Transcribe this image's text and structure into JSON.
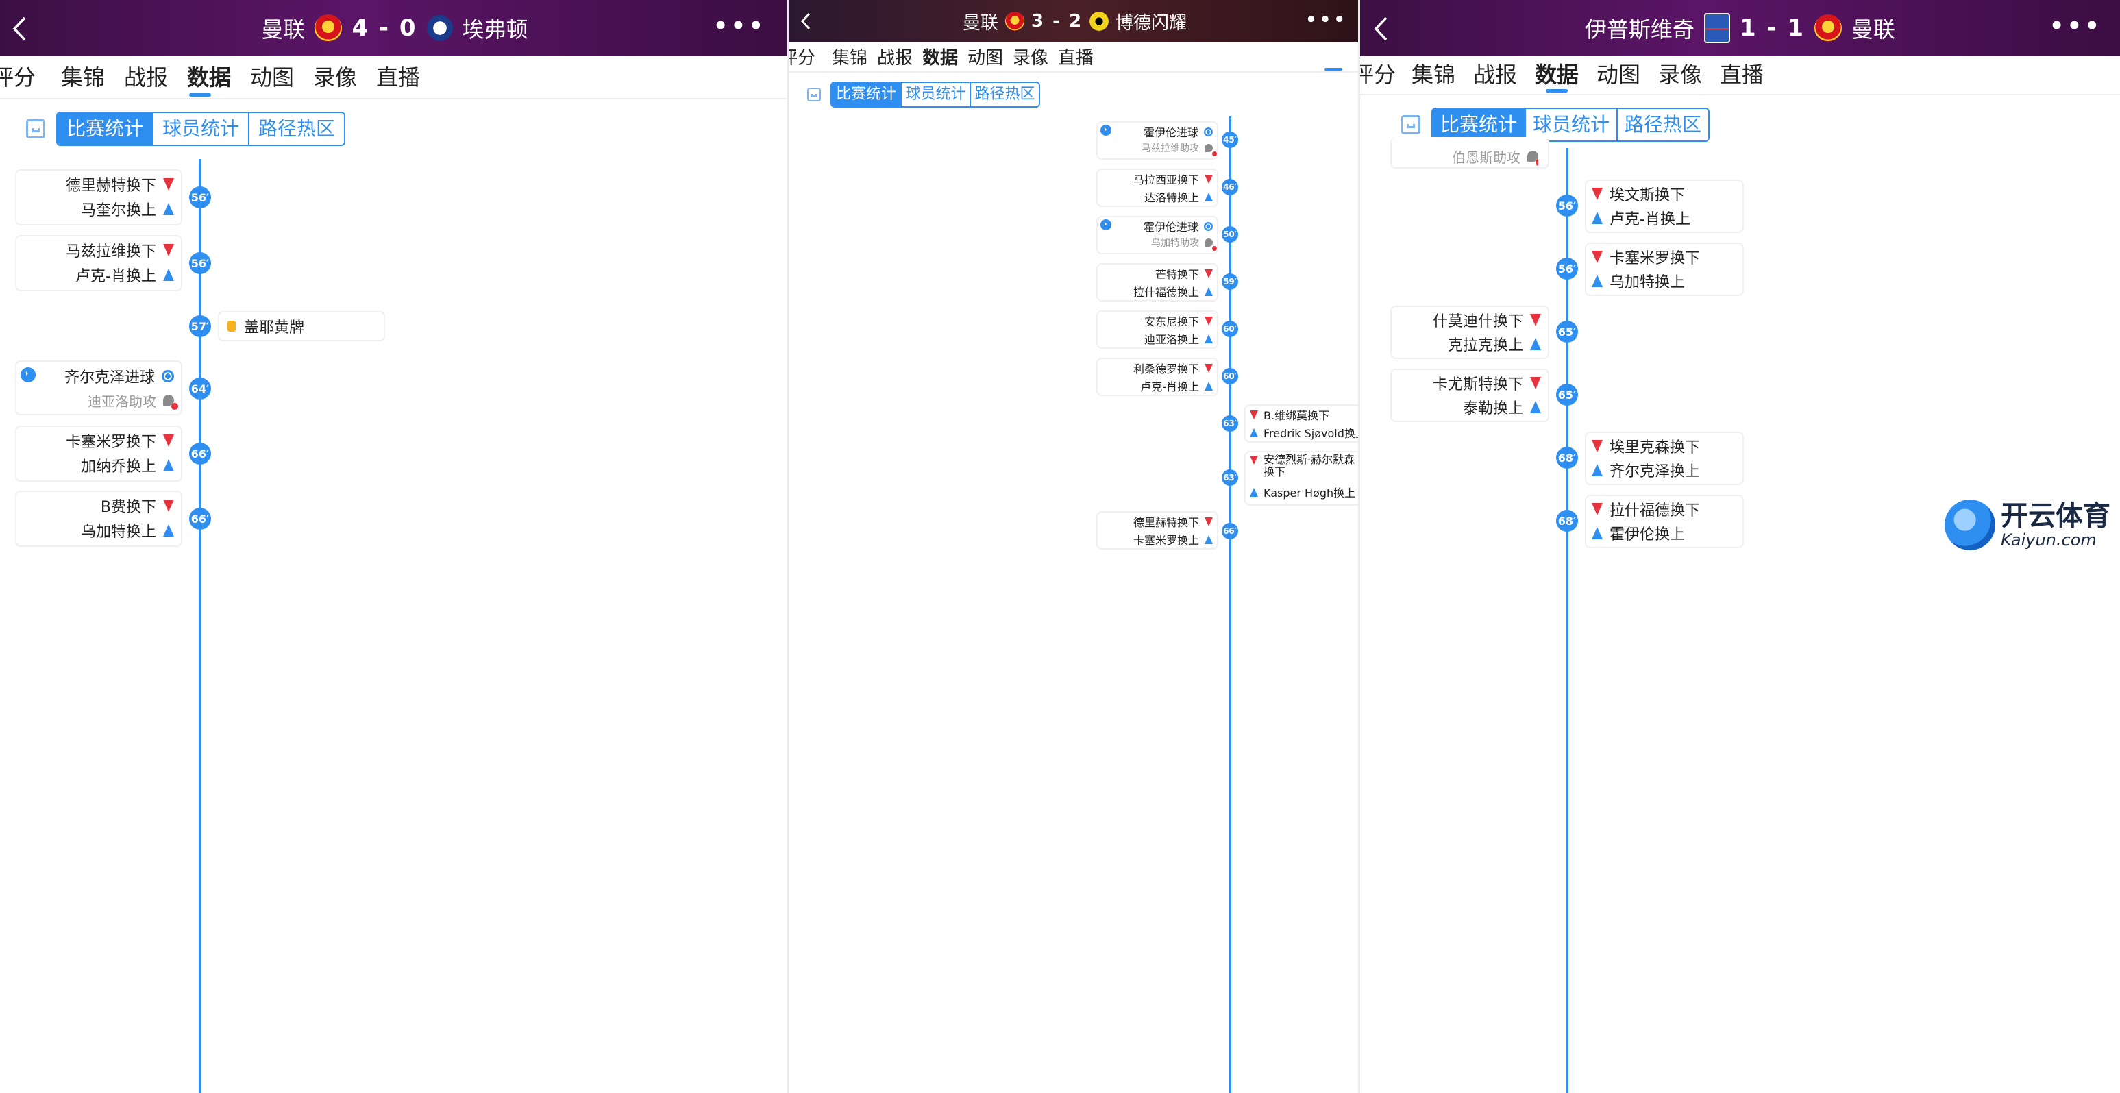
{
  "tabs": [
    "评分",
    "集锦",
    "战报",
    "数据",
    "动图",
    "录像",
    "直播"
  ],
  "active_tab": "数据",
  "segments": [
    "比赛统计",
    "球员统计",
    "路径热区"
  ],
  "active_segment": "比赛统计",
  "panels": [
    {
      "home": "曼联",
      "score": "4 - 0",
      "away": "埃弗顿",
      "events": [
        {
          "minute": "56′",
          "side": "left",
          "type": "sub",
          "off": "德里赫特换下",
          "on": "马奎尔换上"
        },
        {
          "minute": "56′",
          "side": "left",
          "type": "sub",
          "off": "马兹拉维换下",
          "on": "卢克-肖换上"
        },
        {
          "minute": "57′",
          "side": "right",
          "type": "yellow",
          "text": "盖耶黄牌"
        },
        {
          "minute": "64′",
          "side": "left",
          "type": "goal",
          "text": "齐尔克泽进球",
          "assist": "迪亚洛助攻"
        },
        {
          "minute": "66′",
          "side": "left",
          "type": "sub",
          "off": "卡塞米罗换下",
          "on": "加纳乔换上"
        },
        {
          "minute": "66′",
          "side": "left",
          "type": "sub",
          "off": "B费换下",
          "on": "乌加特换上"
        }
      ]
    },
    {
      "home": "曼联",
      "score": "3 - 2",
      "away": "博德闪耀",
      "events": [
        {
          "minute": "45′",
          "side": "left",
          "type": "goal",
          "text": "霍伊伦进球",
          "assist": "马兹拉维助攻"
        },
        {
          "minute": "46′",
          "side": "left",
          "type": "sub",
          "off": "马拉西亚换下",
          "on": "达洛特换上"
        },
        {
          "minute": "50′",
          "side": "left",
          "type": "goal",
          "text": "霍伊伦进球",
          "assist": "乌加特助攻"
        },
        {
          "minute": "59′",
          "side": "left",
          "type": "sub",
          "off": "芒特换下",
          "on": "拉什福德换上"
        },
        {
          "minute": "60′",
          "side": "left",
          "type": "sub",
          "off": "安东尼换下",
          "on": "迪亚洛换上"
        },
        {
          "minute": "60′",
          "side": "left",
          "type": "sub",
          "off": "利桑德罗换下",
          "on": "卢克-肖换上"
        },
        {
          "minute": "63′",
          "side": "right",
          "type": "sub",
          "off": "B.维绑莫换下",
          "on": "Fredrik Sjøvold换上"
        },
        {
          "minute": "63′",
          "side": "right",
          "type": "sub",
          "off": "安德烈斯·赫尔默森换下",
          "on": "Kasper Høgh换上"
        },
        {
          "minute": "66′",
          "side": "left",
          "type": "sub",
          "off": "德里赫特换下",
          "on": "卡塞米罗换上"
        }
      ]
    },
    {
      "home": "伊普斯维奇",
      "score": "1 - 1",
      "away": "曼联",
      "partial_top": "伯恩斯助攻",
      "events": [
        {
          "minute": "56′",
          "side": "right",
          "type": "sub",
          "off": "埃文斯换下",
          "on": "卢克-肖换上"
        },
        {
          "minute": "56′",
          "side": "right",
          "type": "sub",
          "off": "卡塞米罗换下",
          "on": "乌加特换上"
        },
        {
          "minute": "65′",
          "side": "left",
          "type": "sub",
          "off": "什莫迪什换下",
          "on": "克拉克换上"
        },
        {
          "minute": "65′",
          "side": "left",
          "type": "sub",
          "off": "卡尤斯特换下",
          "on": "泰勒换上"
        },
        {
          "minute": "68′",
          "side": "right",
          "type": "sub",
          "off": "埃里克森换下",
          "on": "齐尔克泽换上"
        },
        {
          "minute": "68′",
          "side": "right",
          "type": "sub",
          "off": "拉什福德换下",
          "on": "霍伊伦换上"
        }
      ]
    }
  ],
  "watermark": {
    "title": "开云体育",
    "url": "Kaiyun.com"
  },
  "icons": {
    "back": "chevron-left-icon",
    "more": "more-dots-icon",
    "layout": "layout-icon"
  },
  "colors": {
    "accent": "#2e8ff0",
    "header": "#4a1356",
    "sub_off": "#e8333f",
    "yellow_card": "#f5b21b"
  }
}
